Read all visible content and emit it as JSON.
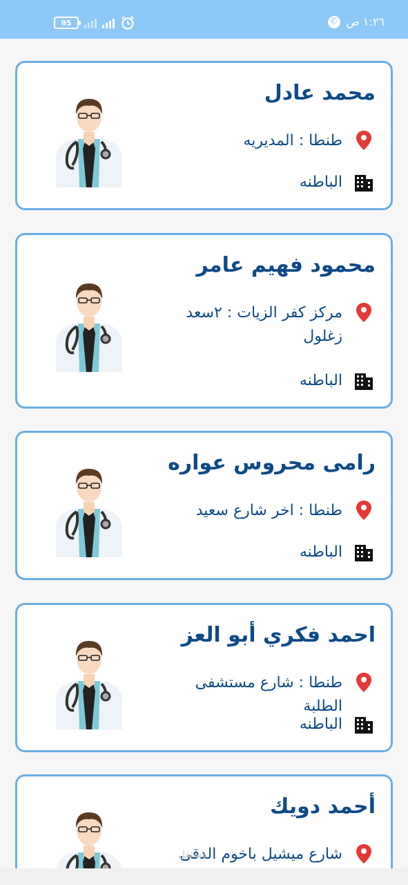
{
  "status_bar": {
    "time": "١:٢٦ ص",
    "battery": "95",
    "icons": [
      "battery-icon",
      "signal-icon",
      "alarm-icon",
      "call-icon"
    ]
  },
  "colors": {
    "status_bar": "#8ec8f7",
    "accent": "#0d4a86",
    "card_border": "#6aaee4",
    "pin": "#e53935"
  },
  "doctors": [
    {
      "name": "محمد عادل",
      "address": "طنطا : المديريه",
      "specialty": "الباطنه"
    },
    {
      "name": "محمود فهيم عامر",
      "address": "مركز كفر الزيات : ٢سعد زغلول",
      "specialty": "الباطنه"
    },
    {
      "name": "رامى محروس عواره",
      "address": "طنطا : اخر شارع سعيد",
      "specialty": "الباطنه"
    },
    {
      "name": "احمد فكري أبو العز",
      "address": "طنطا : شارع مستشفى الطلبة",
      "specialty": "الباطنه"
    },
    {
      "name": "أحمد دويك",
      "address": "شارع ميشيل باخوم الدقى",
      "specialty": ""
    }
  ],
  "watermark": "مستقل"
}
